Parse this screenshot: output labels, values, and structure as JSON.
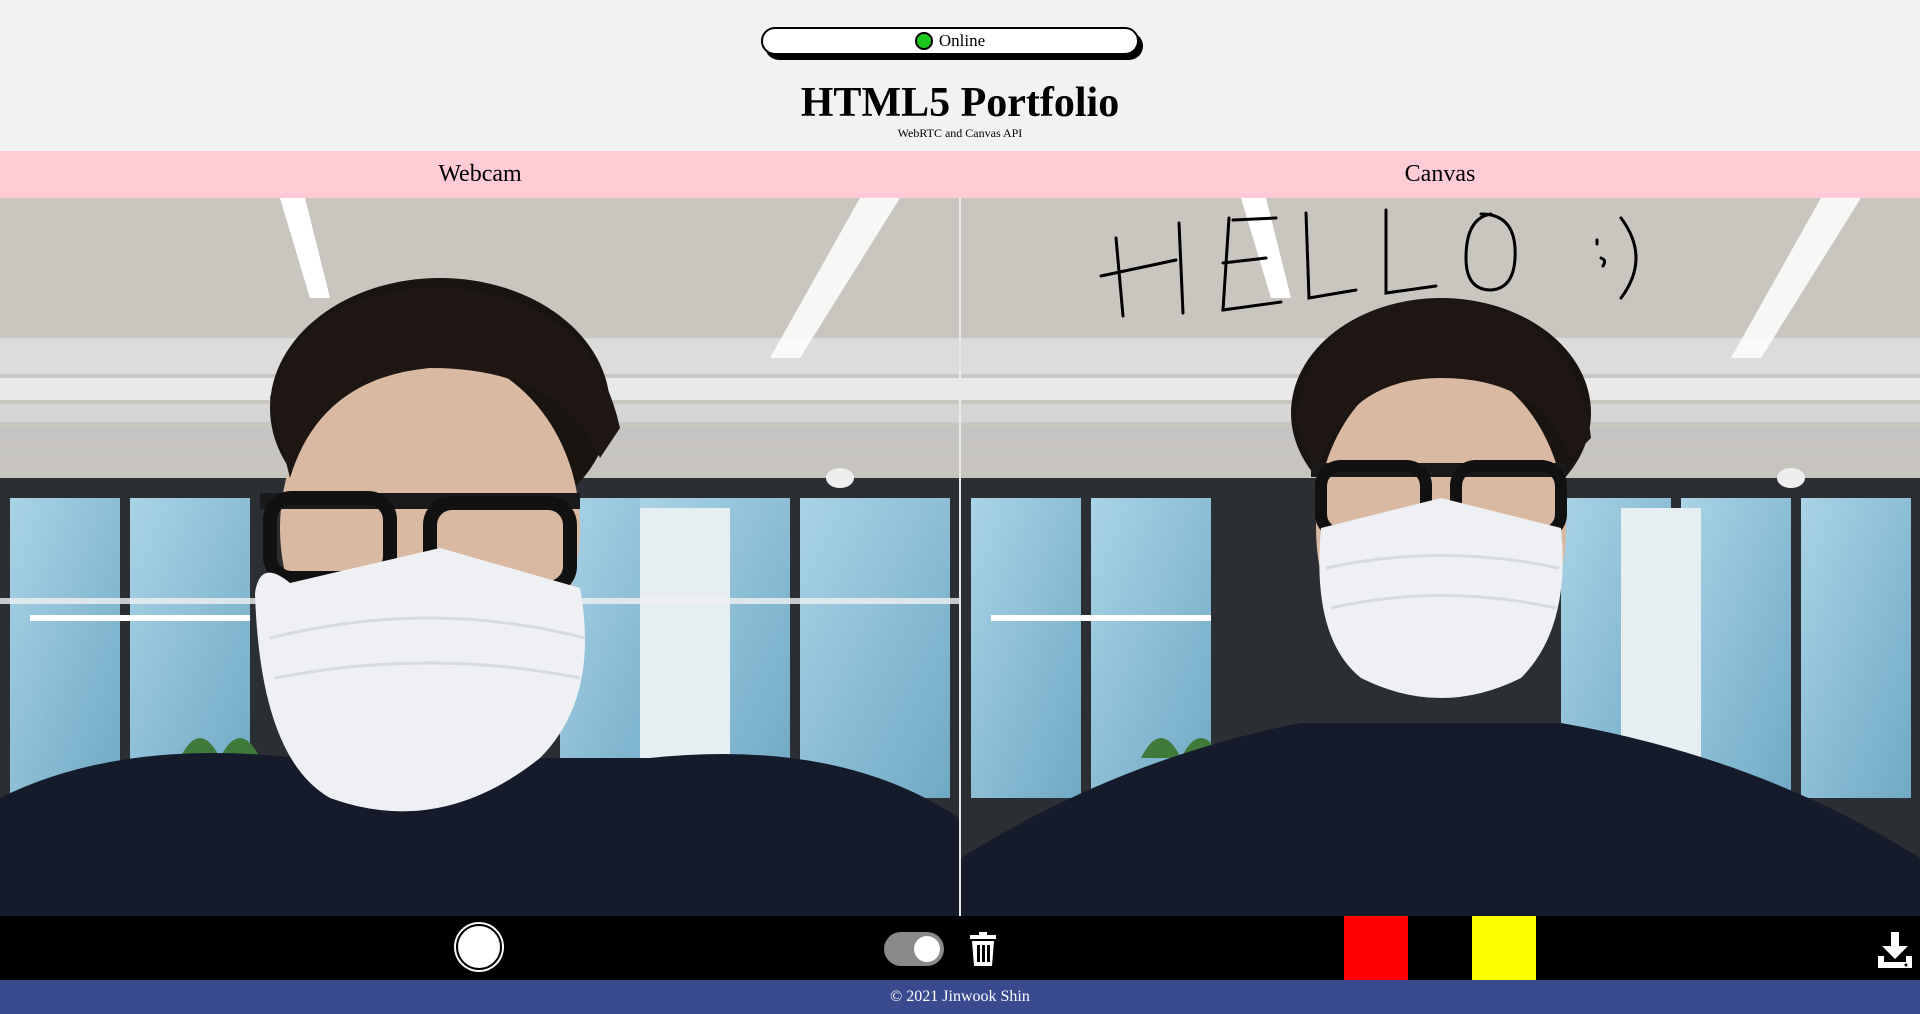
{
  "status": {
    "label": "Online",
    "color": "#1ec51e"
  },
  "header": {
    "title": "HTML5 Portfolio",
    "subtitle": "WebRTC and Canvas API"
  },
  "panels": {
    "left_title": "Webcam",
    "right_title": "Canvas"
  },
  "canvas_drawing": {
    "text": "HELLO :)"
  },
  "toolbar": {
    "capture_icon": "circle-shutter-icon",
    "toggle_icon": "toggle-switch",
    "toggle_on": true,
    "trash_icon": "trash-icon",
    "colors": [
      "#ff0000",
      "#000000",
      "#ffff00"
    ],
    "download_icon": "download-icon"
  },
  "footer": {
    "text": "© 2021 Jinwook Shin"
  }
}
